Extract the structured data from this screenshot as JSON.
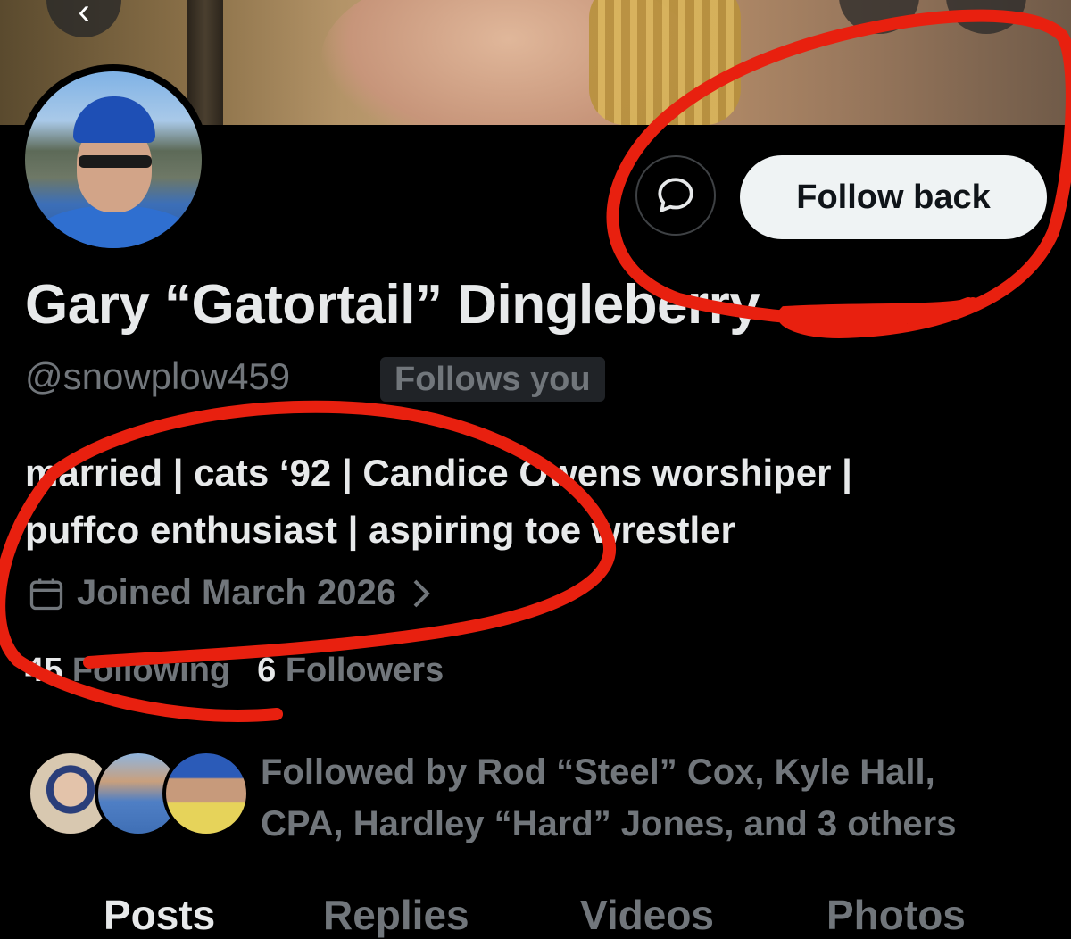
{
  "header": {
    "back_icon": "arrow-left-icon"
  },
  "profile": {
    "display_name": "Gary “Gatortail” Dingleberry",
    "handle": "@snowplow459",
    "follows_you_badge": "Follows you",
    "bio_line1": "married | cats ‘92 | Candice Owens worshiper |",
    "bio_line2": "puffco enthusiast | aspiring toe wrestler",
    "joined": "Joined March 2026",
    "following_count": "45",
    "following_label": "Following",
    "followers_count": "6",
    "followers_label": "Followers",
    "followed_by_line1": "Followed by Rod “Steel” Cox, Kyle Hall,",
    "followed_by_line2": "CPA, Hardley “Hard” Jones, and 3 others"
  },
  "actions": {
    "message_icon": "message-bubble-icon",
    "follow_back_label": "Follow back"
  },
  "tabs": [
    {
      "label": "Posts",
      "active": true
    },
    {
      "label": "Replies",
      "active": false
    },
    {
      "label": "Videos",
      "active": false
    },
    {
      "label": "Photos",
      "active": false
    }
  ],
  "colors": {
    "background": "#000000",
    "primary_text": "#e7e9ea",
    "secondary_text": "#71767b",
    "follow_button_bg": "#eff3f4",
    "annotation_red": "#e8200f"
  }
}
